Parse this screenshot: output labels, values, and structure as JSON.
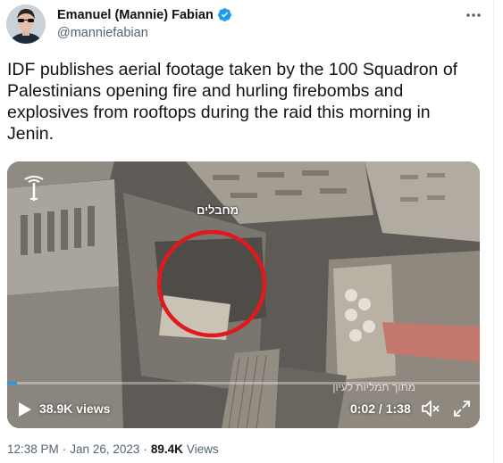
{
  "tweet": {
    "author": {
      "display_name": "Emanuel (Mannie) Fabian",
      "handle": "@manniefabian",
      "verified": true,
      "verified_color": "#1d9bf0"
    },
    "text": "IDF publishes aerial footage taken by the 100 Squadron of Palestinians opening fire and hurling firebombs and explosives from rooftops during the raid this morning in Jenin.",
    "more_icon": "more-horizontal-icon",
    "media": {
      "overlay_label": "מחבלים",
      "watermark": "מתוך תמליות לעיון",
      "views": "38.9K views",
      "current_time": "0:02",
      "time_separator": " / ",
      "duration": "1:38",
      "progress_fraction": 0.02,
      "highlight_color": "#e0191c"
    },
    "meta": {
      "time": "12:38 PM",
      "separator": "·",
      "date": "Jan 26, 2023",
      "views_count": "89.4K",
      "views_label": "Views"
    }
  }
}
